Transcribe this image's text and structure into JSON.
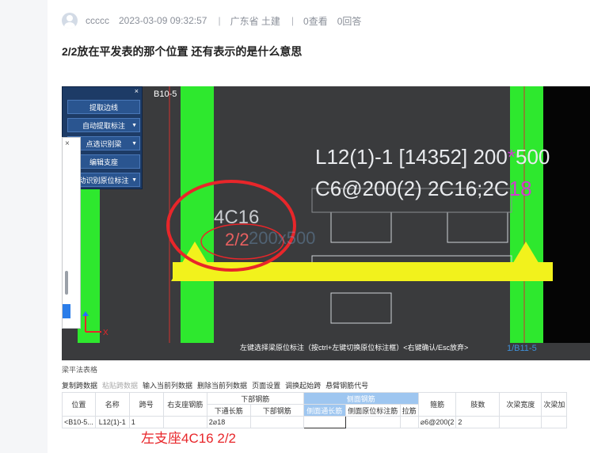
{
  "post": {
    "username": "ccccc",
    "timestamp": "2023-03-09 09:32:57",
    "location": "广东省  土建",
    "views": "0查看",
    "answers": "0回答",
    "separator": "|",
    "question": "2/2放在平发表的那个位置 还有表示的是什么意思"
  },
  "panel": {
    "close": "×",
    "buttons": [
      "提取边线",
      "自动提取标注",
      "点选识别梁",
      "编辑支座",
      "动识别原位标注"
    ],
    "arrow": "▼"
  },
  "cad": {
    "axis_top": "B10-5",
    "axis_bottom": "1/B11-5",
    "beam_name": "L12(1)-1 [14352] 200",
    "beam_star": "*",
    "beam_height": "500",
    "stirrup": "C6@200(2) 2C16;2C",
    "stirrup_tail": "18",
    "support_rebar": "4C16",
    "support_ratio": "2/2",
    "ghost_text": "200x500",
    "command": "左键选择梁原位标注（按ctrl+左键切换原位标注框）<右键确认/Esc放弃>"
  },
  "table": {
    "title": "梁平法表格",
    "toolbar": [
      "复制跨数据",
      "粘贴跨数据",
      "输入当前列数据",
      "删除当前列数据",
      "页面设置",
      "调换起始跨",
      "悬臂钢筋代号"
    ],
    "group_headers": {
      "lower": "下部钢筋",
      "side": "侧面钢筋"
    },
    "columns": [
      "位置",
      "名称",
      "跨号",
      "右支座钢筋",
      "下通长筋",
      "下部钢筋",
      "侧面通长筋",
      "侧面原位标注筋",
      "拉筋",
      "箍筋",
      "肢数",
      "次梁宽度",
      "次梁加"
    ],
    "row": [
      "<B10-5...",
      "L12(1)-1",
      "1",
      "",
      "2⌀18",
      "",
      "",
      "",
      "",
      "⌀6@200(2",
      "2",
      "",
      ""
    ]
  },
  "caption": "左支座4C16 2/2",
  "colors": {
    "green": "#2ee82e",
    "yellow": "#f2f21c",
    "red": "#e8262a",
    "cad_bg": "#3a3b3d",
    "magenta": "#d23ad2"
  }
}
